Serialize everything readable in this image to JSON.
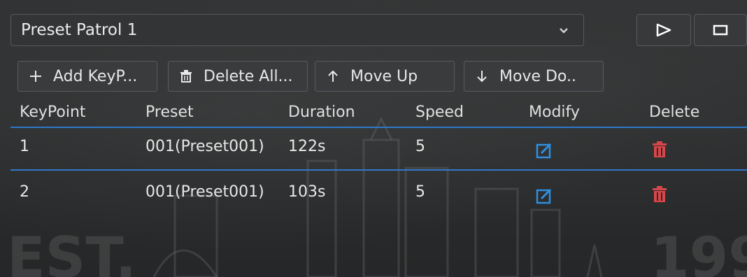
{
  "patrol": {
    "selected": "Preset Patrol 1"
  },
  "toolbar": {
    "add_label": "Add KeyP...",
    "delete_all_label": "Delete All...",
    "move_up_label": "Move Up",
    "move_down_label": "Move Do.."
  },
  "table": {
    "headers": [
      "KeyPoint",
      "Preset",
      "Duration",
      "Speed",
      "Modify",
      "Delete"
    ],
    "rows": [
      {
        "keypoint": "1",
        "preset": "001(Preset001)",
        "duration": "122s",
        "speed": "5"
      },
      {
        "keypoint": "2",
        "preset": "001(Preset001)",
        "duration": "103s",
        "speed": "5"
      }
    ]
  },
  "icons": {
    "dropdown": "chevron-down-icon",
    "play": "play-icon",
    "stop": "stop-icon",
    "add": "plus-icon",
    "delete_all": "trash-icon",
    "move_up": "arrow-up-icon",
    "move_down": "arrow-down-icon",
    "modify": "edit-icon",
    "delete": "trash-icon"
  },
  "colors": {
    "accent": "#2f78c9",
    "edit": "#2f8fe0",
    "delete": "#d9464a"
  }
}
